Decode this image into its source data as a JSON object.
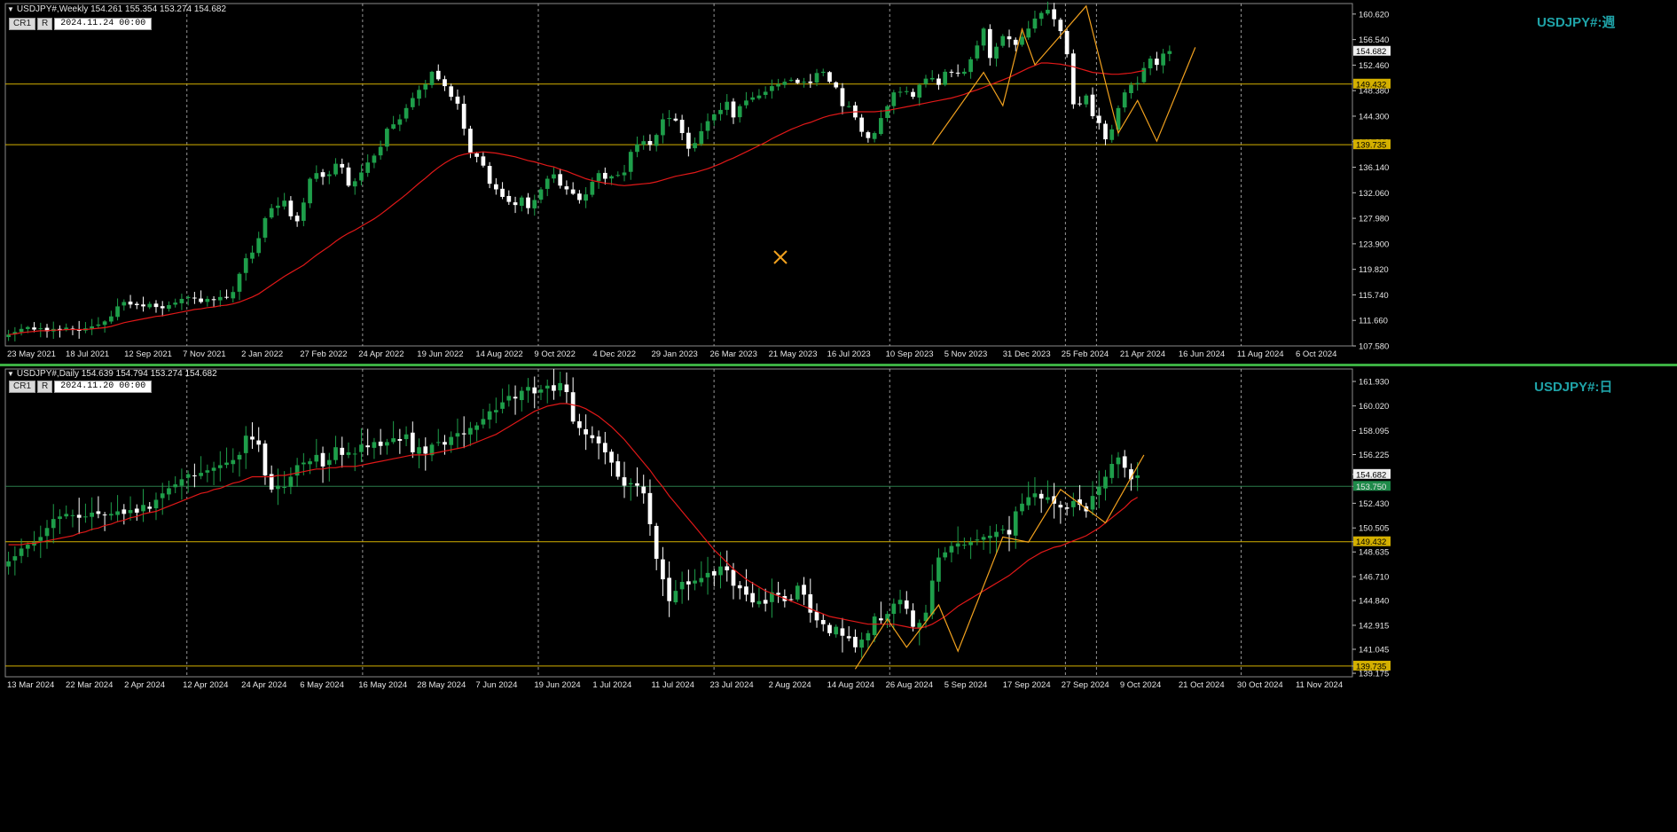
{
  "colors": {
    "background": "#000000",
    "up_candle": "#1e9e4a",
    "down_candle": "#ffffff",
    "ma_line": "#e01818",
    "zigzag": "#f0a01e",
    "hline": "#d4b000",
    "hline_bid": "#2a7a4a",
    "grid": "#c8c8c8",
    "watermark": "#1fa3a8",
    "separator": "#3cb043"
  },
  "weekly": {
    "header": "USDJPY#,Weekly  154.261 155.354 153.274 154.682",
    "btn_cr": "CR1",
    "btn_r": "R",
    "datetime": "2024.11.24 00:00",
    "watermark": "USDJPY#:週",
    "price_labels": [
      "160.620",
      "156.540",
      "152.460",
      "148.380",
      "144.300",
      "140.220",
      "136.140",
      "132.060",
      "127.980",
      "123.900",
      "119.820",
      "115.740",
      "111.660",
      "107.580"
    ],
    "hlines": [
      {
        "price": 149.432,
        "label": "149.432"
      },
      {
        "price": 139.735,
        "label": "139.735"
      }
    ],
    "current": {
      "price": 154.682,
      "label": "154.682"
    },
    "date_labels": [
      "23 May 2021",
      "18 Jul 2021",
      "12 Sep 2021",
      "7 Nov 2021",
      "2 Jan 2022",
      "27 Feb 2022",
      "24 Apr 2022",
      "19 Jun 2022",
      "14 Aug 2022",
      "9 Oct 2022",
      "4 Dec 2022",
      "29 Jan 2023",
      "26 Mar 2023",
      "21 May 2023",
      "16 Jul 2023",
      "10 Sep 2023",
      "5 Nov 2023",
      "31 Dec 2023",
      "25 Feb 2024",
      "21 Apr 2024",
      "16 Jun 2024",
      "11 Aug 2024",
      "6 Oct 2024"
    ],
    "price_min": 107.58,
    "price_max": 162.3,
    "bars_total": 210,
    "closes": [
      109.4,
      109.8,
      110.3,
      110.6,
      110.2,
      110.4,
      109.9,
      110.3,
      110.1,
      110.5,
      110.2,
      110.0,
      110.4,
      110.7,
      111.0,
      111.5,
      112.3,
      113.9,
      114.6,
      114.2,
      114.1,
      113.9,
      114.3,
      113.8,
      113.6,
      114.1,
      114.5,
      115.1,
      115.4,
      115.2,
      114.6,
      115.1,
      114.9,
      115.4,
      115.3,
      116.2,
      119.1,
      121.6,
      122.5,
      124.8,
      128.0,
      129.6,
      130.0,
      130.8,
      128.3,
      127.5,
      130.5,
      134.3,
      135.2,
      134.6,
      135.0,
      136.7,
      136.1,
      133.2,
      133.9,
      135.3,
      136.9,
      138.0,
      139.4,
      142.3,
      143.0,
      143.8,
      145.6,
      147.2,
      148.5,
      149.4,
      151.4,
      150.2,
      149.1,
      147.4,
      146.3,
      142.3,
      138.5,
      137.8,
      136.4,
      133.5,
      132.6,
      131.4,
      130.6,
      130.1,
      131.3,
      129.6,
      130.9,
      132.6,
      134.3,
      135.0,
      133.2,
      132.6,
      131.9,
      130.9,
      131.8,
      133.8,
      135.2,
      134.3,
      134.7,
      134.9,
      135.3,
      138.6,
      139.8,
      140.3,
      139.7,
      141.3,
      143.8,
      144.0,
      143.6,
      141.6,
      139.1,
      140.0,
      141.9,
      143.5,
      144.6,
      145.3,
      146.6,
      144.1,
      145.9,
      146.8,
      147.3,
      147.6,
      148.2,
      149.1,
      149.4,
      149.8,
      150.1,
      149.6,
      149.8,
      149.6,
      151.2,
      151.4,
      149.8,
      148.9,
      145.9,
      145.9,
      144.1,
      141.8,
      140.8,
      141.6,
      144.0,
      145.9,
      148.1,
      148.2,
      148.3,
      147.4,
      149.3,
      150.3,
      150.4,
      149.3,
      151.4,
      151.3,
      151.2,
      151.4,
      153.4,
      155.6,
      158.3,
      153.6,
      155.4,
      157.1,
      156.6,
      155.7,
      157.0,
      158.3,
      159.9,
      160.8,
      161.3,
      159.8,
      157.9,
      154.2,
      146.2,
      146.3,
      147.6,
      144.3,
      143.2,
      140.6,
      142.2,
      145.6,
      148.1,
      149.3,
      149.6,
      152.0,
      153.5,
      152.5,
      154.3,
      154.7
    ],
    "ma": [
      109.4,
      109.5,
      109.7,
      109.8,
      109.9,
      110.0,
      110.0,
      110.1,
      110.1,
      110.2,
      110.2,
      110.2,
      110.2,
      110.3,
      110.4,
      110.5,
      110.7,
      111.0,
      111.3,
      111.5,
      111.7,
      111.9,
      112.1,
      112.3,
      112.4,
      112.6,
      112.8,
      113.0,
      113.2,
      113.4,
      113.5,
      113.7,
      113.8,
      114.0,
      114.1,
      114.3,
      114.6,
      115.0,
      115.4,
      115.9,
      116.6,
      117.3,
      118.0,
      118.7,
      119.3,
      119.9,
      120.5,
      121.3,
      122.1,
      122.8,
      123.5,
      124.3,
      125.0,
      125.6,
      126.1,
      126.7,
      127.3,
      127.9,
      128.6,
      129.4,
      130.2,
      131.0,
      131.8,
      132.7,
      133.6,
      134.4,
      135.3,
      136.1,
      136.8,
      137.4,
      137.9,
      138.2,
      138.4,
      138.5,
      138.6,
      138.5,
      138.4,
      138.2,
      138.0,
      137.8,
      137.5,
      137.2,
      137.0,
      136.7,
      136.4,
      136.2,
      135.8,
      135.5,
      135.1,
      134.7,
      134.3,
      134.0,
      133.8,
      133.6,
      133.5,
      133.3,
      133.2,
      133.3,
      133.4,
      133.5,
      133.6,
      133.8,
      134.1,
      134.4,
      134.7,
      134.9,
      135.1,
      135.3,
      135.6,
      135.9,
      136.3,
      136.7,
      137.2,
      137.6,
      138.1,
      138.6,
      139.1,
      139.6,
      140.1,
      140.7,
      141.2,
      141.7,
      142.2,
      142.6,
      143.0,
      143.3,
      143.7,
      144.1,
      144.4,
      144.6,
      144.8,
      144.9,
      145.0,
      145.0,
      145.0,
      145.0,
      145.1,
      145.2,
      145.4,
      145.6,
      145.8,
      146.0,
      146.2,
      146.4,
      146.6,
      146.8,
      147.0,
      147.2,
      147.5,
      147.8,
      148.2,
      148.5,
      148.9,
      149.3,
      149.7,
      150.1,
      150.5,
      151.0,
      151.5,
      152.0,
      152.4,
      152.8,
      152.8,
      152.7,
      152.6,
      152.4,
      152.2,
      151.9,
      151.6,
      151.3,
      151.2,
      151.1,
      151.0,
      151.0,
      151.1,
      151.2,
      151.4,
      151.6
    ],
    "zigzag": [
      [
        144,
        139.7
      ],
      [
        152,
        151.3
      ],
      [
        155,
        146.0
      ],
      [
        158,
        158.2
      ],
      [
        160,
        152.5
      ],
      [
        168,
        161.9
      ],
      [
        173,
        141.6
      ],
      [
        176,
        146.8
      ],
      [
        179,
        140.3
      ],
      [
        185,
        155.3
      ]
    ]
  },
  "daily": {
    "header": "USDJPY#,Daily  154.639 154.794 153.274 154.682",
    "btn_cr": "CR1",
    "btn_r": "R",
    "datetime": "2024.11.20 00:00",
    "watermark": "USDJPY#:日",
    "price_labels": [
      "161.930",
      "160.020",
      "158.095",
      "156.225",
      "154.682",
      "153.750",
      "152.430",
      "150.505",
      "149.432",
      "148.635",
      "146.710",
      "144.840",
      "142.915",
      "141.045",
      "139.735",
      "139.175"
    ],
    "hlines": [
      {
        "price": 149.432,
        "label": "149.432"
      },
      {
        "price": 139.735,
        "label": "139.735"
      }
    ],
    "current": {
      "price": 154.682,
      "label": "154.682"
    },
    "bid": {
      "price": 153.75,
      "label": "153.750"
    },
    "date_labels": [
      "13 Mar 2024",
      "22 Mar 2024",
      "2 Apr 2024",
      "12 Apr 2024",
      "24 Apr 2024",
      "6 May 2024",
      "16 May 2024",
      "28 May 2024",
      "7 Jun 2024",
      "19 Jun 2024",
      "1 Jul 2024",
      "11 Jul 2024",
      "23 Jul 2024",
      "2 Aug 2024",
      "14 Aug 2024",
      "26 Aug 2024",
      "5 Sep 2024",
      "17 Sep 2024",
      "27 Sep 2024",
      "9 Oct 2024",
      "21 Oct 2024",
      "30 Oct 2024",
      "11 Nov 2024"
    ],
    "price_min": 138.9,
    "price_max": 162.9,
    "bars_total": 210,
    "closes": [
      147.9,
      148.3,
      148.9,
      149.2,
      149.4,
      149.8,
      150.5,
      151.2,
      151.4,
      151.6,
      151.5,
      151.3,
      151.4,
      151.7,
      151.6,
      151.5,
      151.6,
      151.8,
      151.6,
      151.9,
      151.7,
      152.3,
      152.0,
      152.7,
      153.2,
      153.6,
      153.9,
      154.3,
      154.7,
      154.6,
      154.8,
      155.0,
      155.2,
      155.4,
      155.6,
      155.8,
      156.2,
      157.7,
      157.4,
      157.0,
      154.6,
      153.5,
      153.8,
      153.7,
      154.5,
      155.4,
      155.6,
      155.7,
      156.2,
      155.3,
      155.8,
      156.8,
      156.2,
      156.4,
      156.3,
      157.0,
      156.8,
      157.2,
      156.9,
      157.2,
      157.5,
      157.3,
      157.8,
      156.4,
      156.8,
      156.3,
      157.0,
      157.2,
      157.0,
      157.6,
      157.9,
      157.8,
      158.3,
      158.5,
      159.0,
      159.6,
      159.7,
      160.3,
      160.8,
      160.6,
      161.2,
      161.5,
      161.0,
      161.3,
      161.6,
      161.2,
      161.8,
      161.1,
      158.8,
      158.3,
      157.8,
      157.5,
      157.1,
      156.4,
      155.6,
      154.5,
      153.8,
      154.0,
      153.8,
      153.2,
      150.8,
      148.1,
      146.5,
      144.8,
      145.6,
      146.3,
      146.1,
      146.4,
      146.6,
      147.0,
      146.8,
      147.5,
      147.2,
      146.0,
      145.8,
      145.3,
      144.7,
      144.8,
      144.6,
      145.5,
      145.3,
      144.8,
      144.9,
      146.0,
      145.3,
      143.9,
      143.3,
      143.0,
      142.3,
      142.8,
      142.1,
      141.9,
      141.2,
      141.8,
      142.3,
      143.6,
      143.3,
      143.8,
      144.6,
      144.9,
      144.2,
      142.8,
      143.1,
      143.9,
      146.4,
      148.2,
      148.6,
      149.1,
      149.3,
      149.2,
      149.4,
      149.6,
      149.8,
      149.9,
      150.2,
      150.4,
      150.0,
      151.8,
      152.4,
      152.9,
      153.2,
      152.8,
      152.9,
      152.4,
      152.1,
      152.0,
      152.6,
      152.3,
      151.8,
      153.0,
      153.7,
      154.5,
      155.5,
      156.0,
      155.2,
      154.3,
      154.6
    ],
    "ma": [
      149.2,
      149.2,
      149.2,
      149.3,
      149.3,
      149.4,
      149.5,
      149.6,
      149.7,
      149.8,
      149.9,
      150.1,
      150.2,
      150.4,
      150.5,
      150.7,
      150.8,
      151.0,
      151.1,
      151.3,
      151.4,
      151.6,
      151.7,
      151.8,
      152.0,
      152.2,
      152.4,
      152.6,
      152.8,
      153.0,
      153.2,
      153.3,
      153.5,
      153.6,
      153.8,
      154.0,
      154.1,
      154.3,
      154.5,
      154.5,
      154.5,
      154.5,
      154.6,
      154.6,
      154.7,
      154.8,
      154.9,
      155.0,
      155.1,
      155.1,
      155.2,
      155.2,
      155.3,
      155.3,
      155.3,
      155.4,
      155.5,
      155.6,
      155.7,
      155.8,
      155.9,
      156.0,
      156.1,
      156.2,
      156.2,
      156.2,
      156.3,
      156.4,
      156.5,
      156.6,
      156.7,
      156.8,
      157.0,
      157.2,
      157.4,
      157.6,
      157.8,
      158.1,
      158.4,
      158.7,
      159.0,
      159.3,
      159.6,
      159.8,
      160.0,
      160.1,
      160.2,
      160.2,
      160.1,
      160.0,
      159.8,
      159.5,
      159.2,
      158.8,
      158.4,
      157.9,
      157.4,
      156.8,
      156.2,
      155.6,
      155.0,
      154.3,
      153.7,
      153.0,
      152.4,
      151.8,
      151.2,
      150.6,
      150.0,
      149.4,
      148.8,
      148.3,
      147.8,
      147.3,
      146.9,
      146.5,
      146.2,
      145.9,
      145.6,
      145.4,
      145.2,
      145.0,
      144.8,
      144.6,
      144.4,
      144.2,
      144.0,
      143.8,
      143.6,
      143.5,
      143.4,
      143.3,
      143.2,
      143.1,
      143.0,
      143.0,
      143.0,
      143.0,
      143.0,
      142.9,
      142.8,
      142.7,
      142.7,
      142.8,
      143.0,
      143.3,
      143.6,
      144.0,
      144.4,
      144.7,
      145.0,
      145.3,
      145.6,
      145.9,
      146.2,
      146.5,
      146.8,
      147.2,
      147.6,
      148.0,
      148.3,
      148.6,
      148.8,
      149.0,
      149.1,
      149.3,
      149.5,
      149.7,
      149.9,
      150.2,
      150.5,
      150.9,
      151.3,
      151.7,
      152.1,
      152.6,
      152.9
    ],
    "zigzag": [
      [
        132,
        139.5
      ],
      [
        137,
        143.4
      ],
      [
        140,
        141.2
      ],
      [
        145,
        144.5
      ],
      [
        148,
        140.9
      ],
      [
        155,
        149.8
      ],
      [
        159,
        149.4
      ],
      [
        164,
        153.5
      ],
      [
        171,
        150.9
      ],
      [
        177,
        156.2
      ]
    ]
  }
}
